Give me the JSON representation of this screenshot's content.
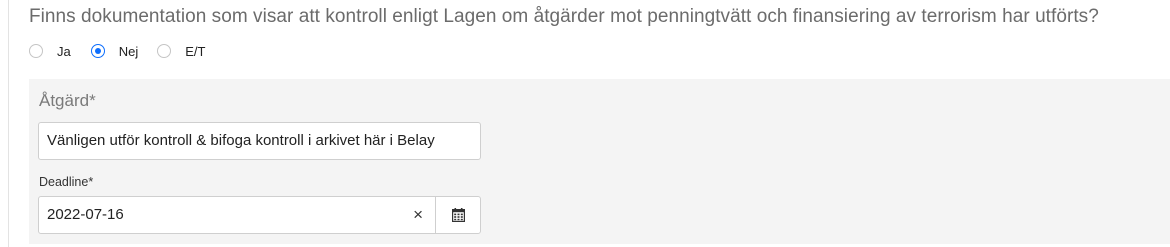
{
  "question": "Finns dokumentation som visar att kontroll enligt Lagen om åtgärder mot penningtvätt och finansiering av terrorism har utförts?",
  "options": [
    {
      "label": "Ja",
      "selected": false
    },
    {
      "label": "Nej",
      "selected": true
    },
    {
      "label": "E/T",
      "selected": false
    }
  ],
  "action": {
    "label": "Åtgärd*",
    "value": "Vänligen utför kontroll & bifoga kontroll i arkivet här i Belay"
  },
  "deadline": {
    "label": "Deadline*",
    "value": "2022-07-16",
    "clear_glyph": "×"
  },
  "icons": {
    "clear": "close-icon",
    "calendar": "calendar-icon"
  },
  "colors": {
    "accent": "#0d6efd",
    "question_text": "#6b6b6b",
    "panel_bg": "#f4f4f4"
  }
}
